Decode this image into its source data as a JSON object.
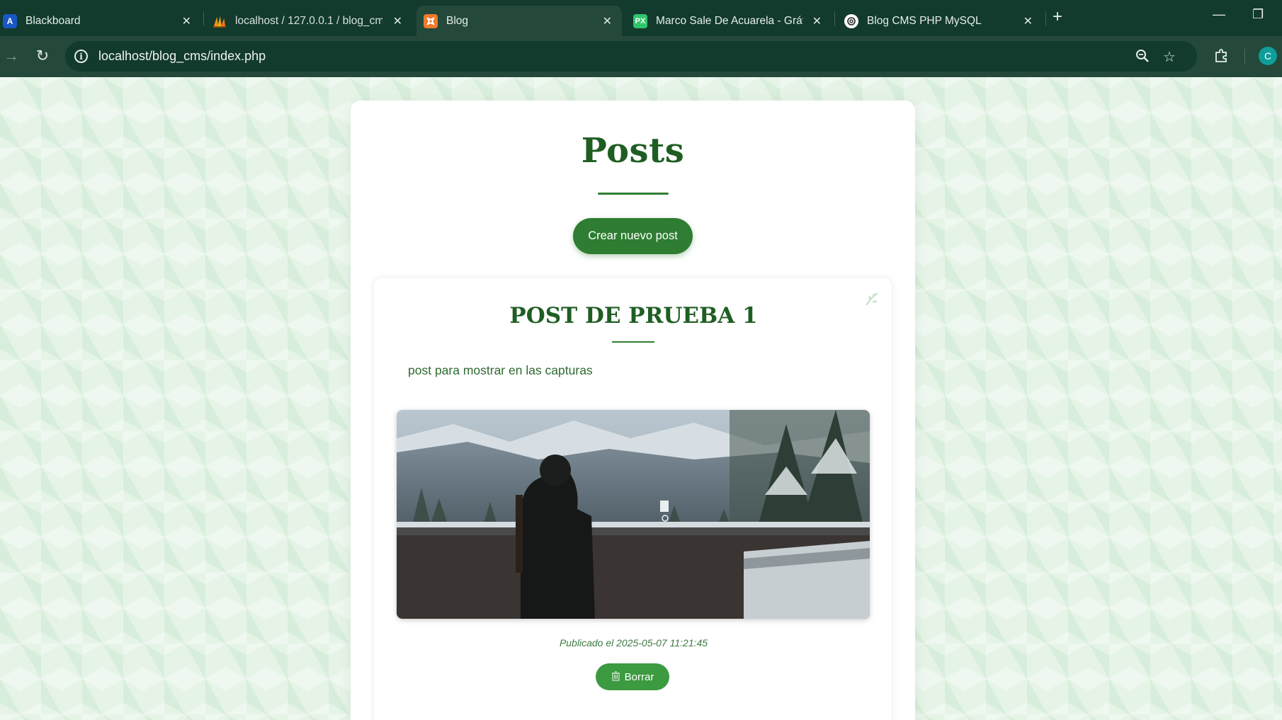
{
  "browser": {
    "tabs": [
      {
        "title": "Blackboard",
        "icon": "blackboard-icon",
        "favicon_text": "A",
        "active": false
      },
      {
        "title": "localhost / 127.0.0.1 / blog_cms",
        "icon": "phpmyadmin-icon",
        "favicon_text": "",
        "active": false
      },
      {
        "title": "Blog",
        "icon": "xampp-icon",
        "favicon_text": "",
        "active": true
      },
      {
        "title": "Marco Sale De Acuarela - Gráfic",
        "icon": "pixabay-icon",
        "favicon_text": "PX",
        "active": false
      },
      {
        "title": "Blog CMS PHP MySQL",
        "icon": "chatgpt-icon",
        "favicon_text": "",
        "active": false
      }
    ],
    "url": "localhost/blog_cms/index.php",
    "profile_initial": "C"
  },
  "page": {
    "title": "Posts",
    "create_button": "Crear nuevo post"
  },
  "post": {
    "title": "POST DE PRUEBA 1",
    "body": "post para mostrar en las capturas",
    "date": "Publicado el 2025-05-07 11:21:45",
    "delete_button": "Borrar"
  },
  "colors": {
    "chrome_dark": "#123a2d",
    "chrome_mid": "#24493b",
    "accent_green": "#2e7d32",
    "heading_green": "#1f5e22",
    "page_background": "#e6f4e8"
  }
}
